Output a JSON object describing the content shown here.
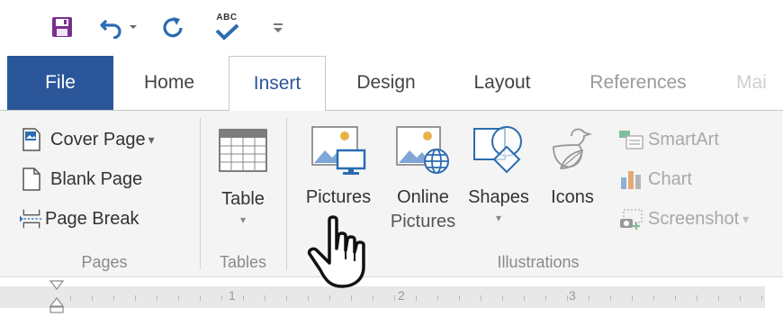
{
  "quick_access": {
    "save_icon": "save-icon",
    "undo_icon": "undo-icon",
    "redo_icon": "redo-icon",
    "spelling_icon": "spelling-check-icon",
    "spelling_text": "ABC",
    "customize_icon": "customize-toolbar-icon"
  },
  "tabs": {
    "file": "File",
    "home": "Home",
    "insert": "Insert",
    "design": "Design",
    "layout": "Layout",
    "references": "References",
    "mailings": "Mai"
  },
  "groups": {
    "pages": {
      "label": "Pages",
      "cover_page": "Cover Page",
      "cover_page_caret": "▾",
      "blank_page": "Blank Page",
      "page_break": "Page Break"
    },
    "tables": {
      "label": "Tables",
      "table": "Table",
      "table_caret": "▾"
    },
    "illustrations": {
      "label": "Illustrations",
      "pictures": "Pictures",
      "online_pictures_line1": "Online",
      "online_pictures_line2": "Pictures",
      "shapes": "Shapes",
      "shapes_caret": "▾",
      "icons": "Icons",
      "smartart": "SmartArt",
      "chart": "Chart",
      "screenshot": "Screenshot",
      "screenshot_caret": "▾"
    }
  },
  "ruler": {
    "numbers": [
      "1",
      "2",
      "3"
    ]
  },
  "colors": {
    "file_tab": "#2b579a",
    "active_tab_text": "#2b579a",
    "save_icon": "#7a2f8f",
    "undo_redo": "#2b6cb0"
  }
}
